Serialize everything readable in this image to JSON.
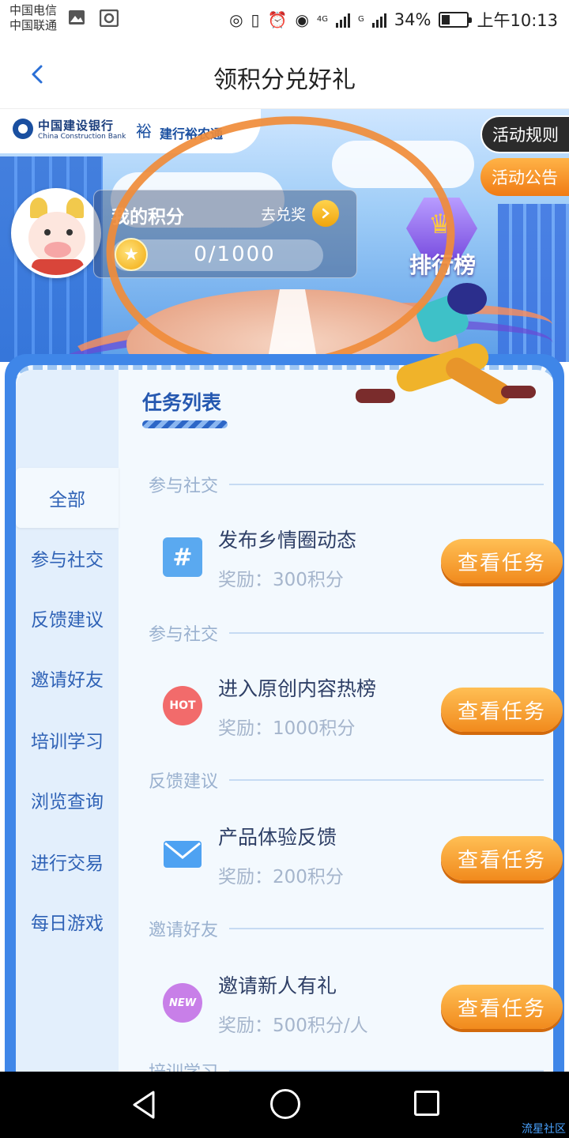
{
  "status_bar": {
    "carrier_1": "中国电信",
    "carrier_2": "中国联通",
    "network_1": "4G",
    "network_2": "G",
    "battery": "34%",
    "battery_level": 0.34,
    "time": "上午10:13"
  },
  "nav": {
    "title": "领积分兑好礼"
  },
  "banner": {
    "bank_name_cn": "中国建设银行",
    "bank_name_en": "China Construction Bank",
    "app_name": "建行裕农通",
    "rules_button": "活动规则",
    "notice_button": "活动公告",
    "points_label": "我的积分",
    "redeem_label": "去兑奖",
    "points_value": "0/1000",
    "points_progress": 0,
    "rank_label": "排行榜",
    "annotation_color": "#f08c3a"
  },
  "tasks_title": "任务列表",
  "sidebar": {
    "items": [
      {
        "label": "全部",
        "active": true
      },
      {
        "label": "参与社交"
      },
      {
        "label": "反馈建议"
      },
      {
        "label": "邀请好友"
      },
      {
        "label": "培训学习"
      },
      {
        "label": "浏览查询"
      },
      {
        "label": "进行交易"
      },
      {
        "label": "每日游戏"
      }
    ]
  },
  "task_list": [
    {
      "section": "参与社交",
      "name": "发布乡情圈动态",
      "reward": "奖励：300积分",
      "button": "查看任务",
      "icon": "hashtag-icon",
      "icon_text": "#"
    },
    {
      "section": "参与社交",
      "name": "进入原创内容热榜",
      "reward": "奖励：1000积分",
      "button": "查看任务",
      "icon": "hot-icon",
      "icon_text": "HOT"
    },
    {
      "section": "反馈建议",
      "name": "产品体验反馈",
      "reward": "奖励：200积分",
      "button": "查看任务",
      "icon": "mail-icon",
      "icon_text": ""
    },
    {
      "section": "邀请好友",
      "name": "邀请新人有礼",
      "reward": "奖励：500积分/人",
      "button": "查看任务",
      "icon": "new-icon",
      "icon_text": "NEW"
    }
  ],
  "next_section_partial": "培训学习",
  "colors": {
    "accent_blue": "#3f86e8",
    "button_orange": "#f18a1d"
  },
  "watermark": "流星社区"
}
